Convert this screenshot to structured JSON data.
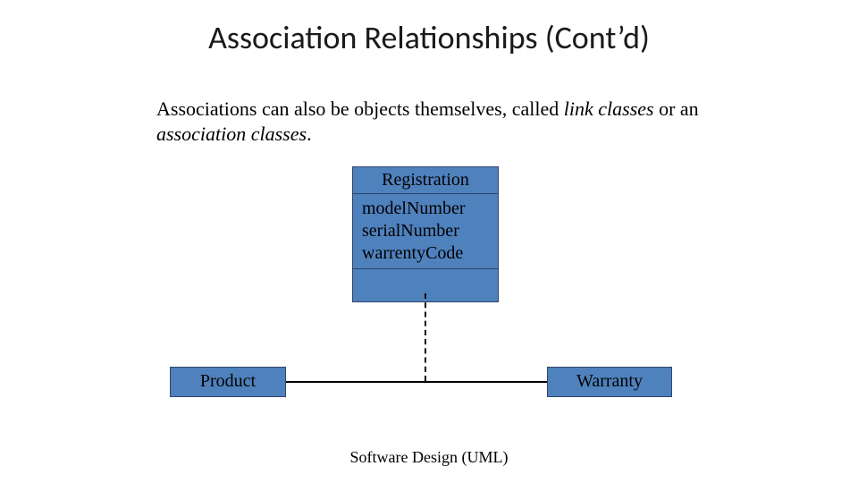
{
  "title": "Association Relationships (Cont’d)",
  "body": {
    "pre": "Associations can also be objects themselves, called ",
    "italic1": "link classes",
    "mid": " or an ",
    "italic2": "association classes",
    "post": "."
  },
  "assoc_class": {
    "name": "Registration",
    "attributes": [
      "modelNumber",
      "serialNumber",
      "warrentyCode"
    ]
  },
  "left_class": "Product",
  "right_class": "Warranty",
  "footer": "Software Design (UML)",
  "colors": {
    "box_fill": "#4f81bd",
    "box_border": "#30456a"
  },
  "chart_data": {
    "type": "diagram",
    "kind": "uml-association-class",
    "classes": [
      {
        "id": "Product",
        "name": "Product"
      },
      {
        "id": "Warranty",
        "name": "Warranty"
      },
      {
        "id": "Registration",
        "name": "Registration",
        "attributes": [
          "modelNumber",
          "serialNumber",
          "warrentyCode"
        ],
        "role": "association-class"
      }
    ],
    "associations": [
      {
        "ends": [
          "Product",
          "Warranty"
        ],
        "association_class": "Registration"
      }
    ]
  }
}
